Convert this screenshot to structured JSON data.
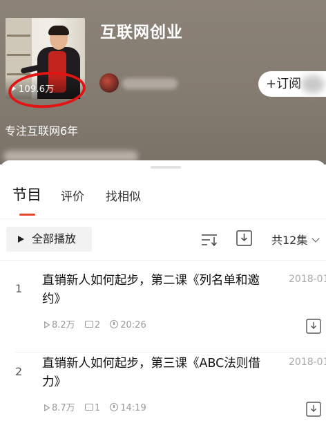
{
  "header": {
    "title": "互联网创业",
    "play_count": "109.6万",
    "subscribe_label": "+订阅",
    "description": "专注互联网6年"
  },
  "tabs": [
    {
      "label": "节目",
      "active": true
    },
    {
      "label": "评价",
      "active": false
    },
    {
      "label": "找相似",
      "active": false
    }
  ],
  "toolbar": {
    "play_all_label": "全部播放",
    "episode_count": "共12集"
  },
  "episodes": [
    {
      "index": "1",
      "title": "直销新人如何起步，第二课《列名单和邀约》",
      "date": "2018-01",
      "plays": "8.2万",
      "comments": "2",
      "duration": "20:26"
    },
    {
      "index": "2",
      "title": "直销新人如何起步，第三课《ABC法则借力》",
      "date": "2018-01",
      "plays": "8.7万",
      "comments": "1",
      "duration": "14:19"
    }
  ],
  "colors": {
    "header_bg": "#857c71",
    "accent": "#e8452c",
    "annotation_ring": "#e21313"
  },
  "icons": [
    "play-icon",
    "sort-icon",
    "download-icon",
    "chevron-down-icon",
    "comment-icon",
    "clock-icon"
  ]
}
